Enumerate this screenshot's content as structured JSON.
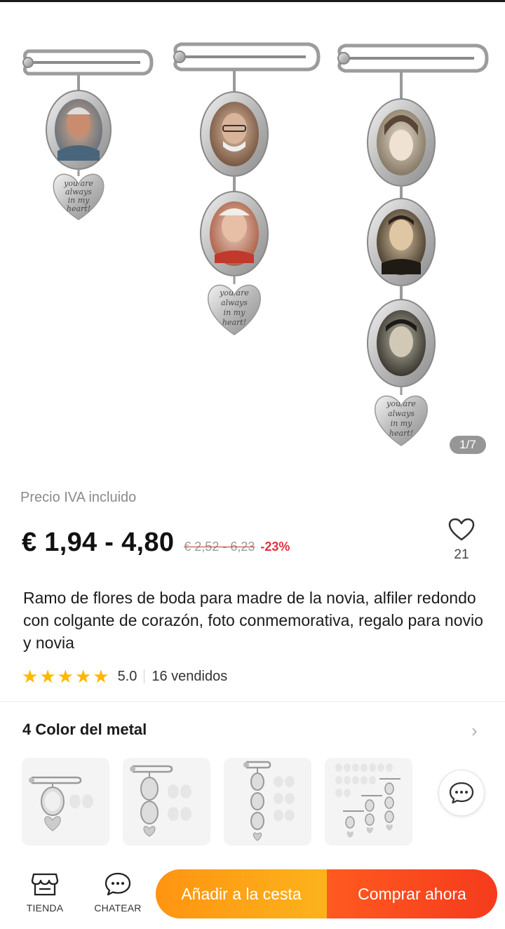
{
  "gallery": {
    "page_indicator": "1/7",
    "heart_engraving": [
      "you are",
      "always",
      "in my",
      "heart!"
    ]
  },
  "price_section": {
    "tax_note": "Precio IVA incluido",
    "price": "€ 1,94 - 4,80",
    "original_price": "€ 2,52 - 6,23",
    "discount": "-23%",
    "wishlist_count": "21"
  },
  "product": {
    "title": "Ramo de flores de boda para madre de la novia, alfiler redondo con colgante de corazón, foto conmemorativa, regalo para novio y novia",
    "rating": "5.0",
    "stars": 5,
    "sold": "16 vendidos"
  },
  "variants": {
    "header": "4 Color del metal"
  },
  "bottom_bar": {
    "store_label": "TIENDA",
    "chat_label": "CHATEAR",
    "add_to_cart": "Añadir a la cesta",
    "buy_now": "Comprar ahora"
  },
  "colors": {
    "price_text": "#111111",
    "discount_red": "#e0323b",
    "star_gold": "#ffb800",
    "cart_orange": "#fca31b",
    "buy_red": "#f5421d"
  },
  "icons": [
    "heart-outline-icon",
    "chevron-right-icon",
    "chat-bubble-icon",
    "store-icon",
    "chat-icon"
  ]
}
